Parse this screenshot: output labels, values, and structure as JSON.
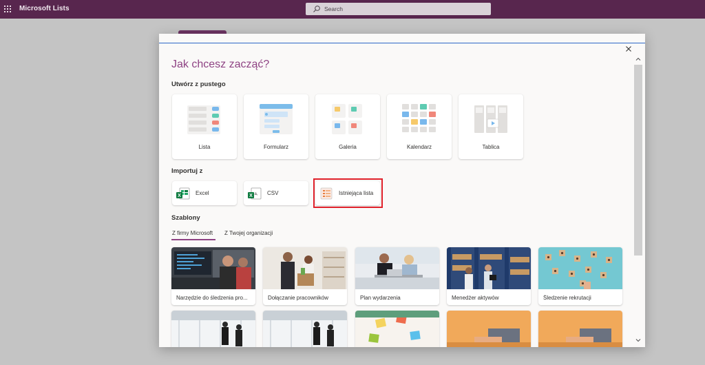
{
  "app": {
    "title": "Microsoft Lists"
  },
  "search": {
    "placeholder": "Search"
  },
  "dialog": {
    "title": "Jak chcesz zacząć?",
    "blank_section": {
      "heading": "Utwórz z pustego",
      "tiles": [
        {
          "label": "Lista",
          "icon": "list-icon"
        },
        {
          "label": "Formularz",
          "icon": "form-icon"
        },
        {
          "label": "Galeria",
          "icon": "gallery-icon"
        },
        {
          "label": "Kalendarz",
          "icon": "calendar-icon"
        },
        {
          "label": "Tablica",
          "icon": "board-icon"
        }
      ]
    },
    "import_section": {
      "heading": "Importuj z",
      "items": [
        {
          "label": "Excel",
          "icon": "excel-icon"
        },
        {
          "label": "CSV",
          "icon": "csv-icon"
        },
        {
          "label": "Istniejąca lista",
          "icon": "existing-list-icon",
          "highlighted": true
        }
      ]
    },
    "templates_section": {
      "heading": "Szablony",
      "tabs": [
        {
          "label": "Z firmy Microsoft",
          "selected": true
        },
        {
          "label": "Z Twojej organizacji",
          "selected": false
        }
      ],
      "cards": [
        {
          "label": "Narzędzie do śledzenia pro..."
        },
        {
          "label": "Dołączanie pracowników"
        },
        {
          "label": "Plan wydarzenia"
        },
        {
          "label": "Menedżer aktywów"
        },
        {
          "label": "Śledzenie rekrutacji"
        }
      ]
    }
  },
  "colors": {
    "appbar": "#58264e",
    "accent": "#8e4283",
    "highlight_border": "#e0202a",
    "overlay": "#c4c4c4"
  }
}
